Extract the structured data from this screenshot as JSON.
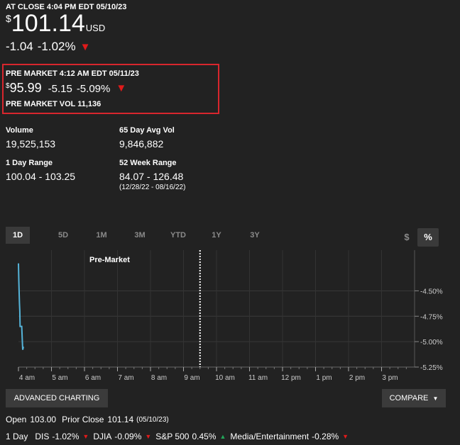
{
  "quote": {
    "close_label": "AT CLOSE 4:04 PM EDT 05/10/23",
    "currency_symbol": "$",
    "price": "101.14",
    "currency": "USD",
    "change": "-1.04",
    "change_pct": "-1.02%"
  },
  "premarket": {
    "label": "PRE MARKET 4:12 AM EDT 05/11/23",
    "currency_symbol": "$",
    "price": "95.99",
    "change": "-5.15",
    "change_pct": "-5.09%",
    "volume_label": "PRE MARKET VOL 11,136"
  },
  "stats": {
    "volume": {
      "label": "Volume",
      "value": "19,525,153"
    },
    "avg_vol": {
      "label": "65 Day Avg Vol",
      "value": "9,846,882"
    },
    "day_range": {
      "label": "1 Day Range",
      "value": "100.04 - 103.25"
    },
    "week52": {
      "label": "52 Week Range",
      "value": "84.07 - 126.48",
      "sub": "(12/28/22 - 08/16/22)"
    }
  },
  "tabs": [
    "1D",
    "5D",
    "1M",
    "3M",
    "YTD",
    "1Y",
    "3Y"
  ],
  "active_tab": "1D",
  "unit_toggle": {
    "dollar": "$",
    "percent": "%"
  },
  "colors": {
    "line": "#55b4d9",
    "down": "#e01a1a",
    "up": "#22a85a",
    "highlight_box": "#d8262d",
    "background": "#222222"
  },
  "chart_data": {
    "type": "line",
    "annotation": "Pre-Market",
    "x_tick_labels": [
      "4 am",
      "5 am",
      "6 am",
      "7 am",
      "8 am",
      "9 am",
      "10 am",
      "11 am",
      "12 pm",
      "1 pm",
      "2 pm",
      "3 pm"
    ],
    "y_tick_labels": [
      "-4.50%",
      "-4.75%",
      "-5.00%",
      "-5.25%"
    ],
    "y_ticks": [
      -4.5,
      -4.75,
      -5.0,
      -5.25
    ],
    "ylim": [
      -5.25,
      -4.1
    ],
    "xlim_hours": [
      4.0,
      16.0
    ],
    "session_marker_hour": 9.5,
    "series": [
      {
        "x_hours": [
          4.0,
          4.01,
          4.02,
          4.03,
          4.04,
          4.05,
          4.06,
          4.08,
          4.1,
          4.12,
          4.13,
          4.15
        ],
        "values": [
          -4.23,
          -4.4,
          -4.5,
          -4.62,
          -4.7,
          -4.85,
          -4.85,
          -4.85,
          -4.85,
          -5.02,
          -5.08,
          -5.05
        ]
      }
    ],
    "grid": true
  },
  "buttons": {
    "advanced": "ADVANCED CHARTING",
    "compare": "COMPARE"
  },
  "prices_row": {
    "open_label": "Open",
    "open_value": "103.00",
    "prior_label": "Prior Close",
    "prior_value": "101.14",
    "prior_date": "(05/10/23)"
  },
  "indices_row": {
    "period": "1 Day",
    "items": [
      {
        "name": "DIS",
        "change": "-1.02%",
        "dir": "down"
      },
      {
        "name": "DJIA",
        "change": "-0.09%",
        "dir": "down"
      },
      {
        "name": "S&P 500",
        "change": "0.45%",
        "dir": "up"
      },
      {
        "name": "Media/Entertainment",
        "change": "-0.28%",
        "dir": "down"
      }
    ]
  }
}
